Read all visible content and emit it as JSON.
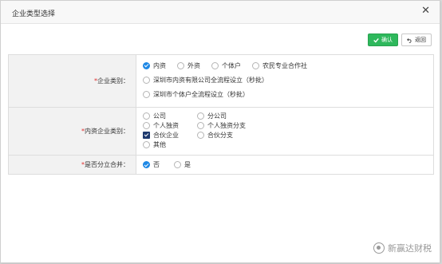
{
  "dialog": {
    "title": "企业类型选择"
  },
  "toolbar": {
    "ok_label": "确认",
    "back_label": "返回"
  },
  "rows": {
    "company_category": {
      "label": "企业类别：",
      "options": [
        "内资",
        "外资",
        "个体户",
        "农民专业合作社",
        "深圳市内资有限公司全流程设立（秒批）",
        "深圳市个体户全流程设立（秒批）"
      ],
      "selected": "内资"
    },
    "domestic_category": {
      "label": "内资企业类别：",
      "options": [
        "公司",
        "分公司",
        "个人独资",
        "个人独资分支",
        "合伙企业",
        "合伙分支",
        "其他"
      ],
      "selected": "合伙企业"
    },
    "split_merge": {
      "label": "是否分立合并：",
      "options": [
        "否",
        "是"
      ],
      "selected": "否"
    }
  },
  "required_mark": "*",
  "watermark": "新赢达财税",
  "colors": {
    "accent": "#1e88e5",
    "ok_button": "#2eb85c",
    "required": "#e02e2e"
  }
}
